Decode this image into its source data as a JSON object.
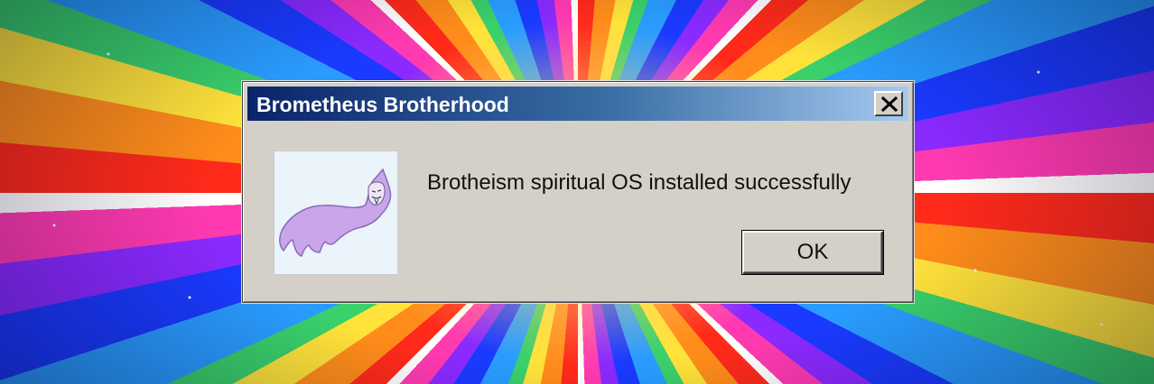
{
  "dialog": {
    "title": "Brometheus Brotherhood",
    "message": "Brotheism spiritual OS installed successfully",
    "ok_label": "OK",
    "close_icon": "close-x-icon",
    "mascot_icon": "purple-hooded-figure-icon"
  },
  "colors": {
    "titlebar_start": "#0a246a",
    "titlebar_end": "#a6caf0",
    "dialog_face": "#d4d0c8",
    "mascot": "#c9a6ea"
  }
}
